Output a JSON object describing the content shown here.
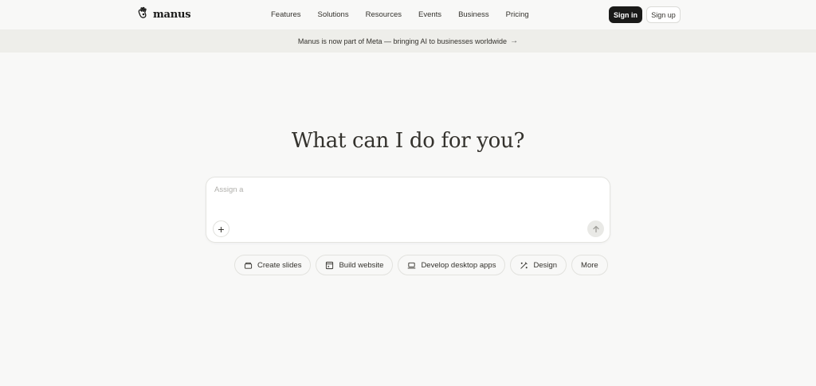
{
  "brand": {
    "name": "manus",
    "logo_icon": "hand-icon"
  },
  "nav": {
    "links": [
      "Features",
      "Solutions",
      "Resources",
      "Events",
      "Business",
      "Pricing"
    ],
    "signin_label": "Sign in",
    "signup_label": "Sign up"
  },
  "banner": {
    "text": "Manus is now part of Meta — bringing AI to businesses worldwide",
    "arrow": "→"
  },
  "hero": {
    "title": "What can I do for you?"
  },
  "composer": {
    "placeholder": "Assign a",
    "value": "",
    "plus_label": "+",
    "send_icon": "arrow-up-icon"
  },
  "chips": [
    {
      "label": "Create slides",
      "icon": "slides-icon"
    },
    {
      "label": "Build website",
      "icon": "website-icon"
    },
    {
      "label": "Develop desktop apps",
      "icon": "laptop-icon"
    },
    {
      "label": "Design",
      "icon": "design-icon"
    },
    {
      "label": "More",
      "icon": ""
    }
  ],
  "colors": {
    "background": "#f8f8f7",
    "banner": "#eeeeea",
    "primary": "#1a1a19",
    "text": "#34322d"
  }
}
